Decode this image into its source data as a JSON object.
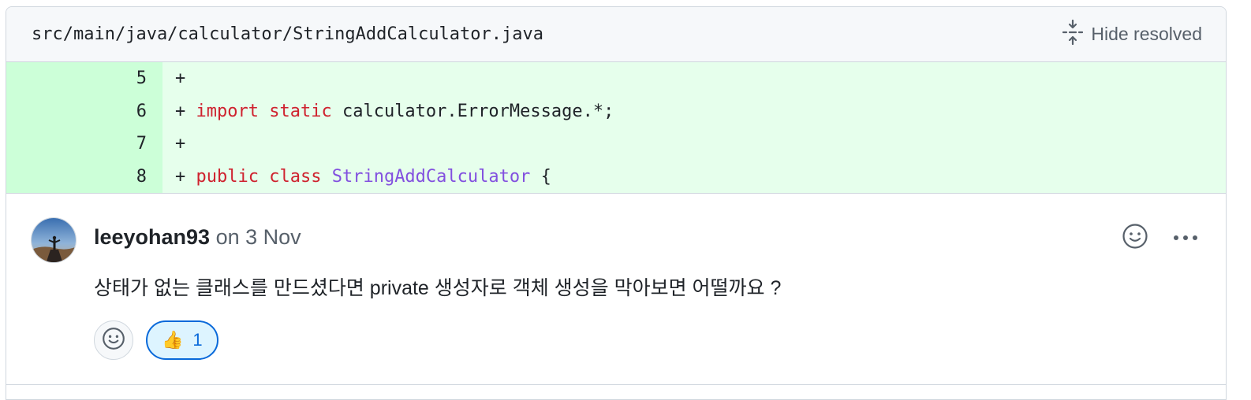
{
  "file": {
    "path": "src/main/java/calculator/StringAddCalculator.java",
    "hide_resolved_label": "Hide resolved"
  },
  "diff": {
    "lines": [
      {
        "number": "5",
        "tokens": [
          {
            "t": "+",
            "k": "plain"
          }
        ]
      },
      {
        "number": "6",
        "tokens": [
          {
            "t": "+ ",
            "k": "plain"
          },
          {
            "t": "import",
            "k": "kw"
          },
          {
            "t": " ",
            "k": "plain"
          },
          {
            "t": "static",
            "k": "kw"
          },
          {
            "t": " calculator.ErrorMessage.*;",
            "k": "plain"
          }
        ]
      },
      {
        "number": "7",
        "tokens": [
          {
            "t": "+",
            "k": "plain"
          }
        ]
      },
      {
        "number": "8",
        "tokens": [
          {
            "t": "+ ",
            "k": "plain"
          },
          {
            "t": "public",
            "k": "kw"
          },
          {
            "t": " ",
            "k": "plain"
          },
          {
            "t": "class",
            "k": "kw"
          },
          {
            "t": " ",
            "k": "plain"
          },
          {
            "t": "StringAddCalculator",
            "k": "cls"
          },
          {
            "t": " {",
            "k": "plain"
          }
        ]
      }
    ]
  },
  "comment": {
    "author": "leeyohan93",
    "date": "on 3 Nov",
    "body": "상태가 없는 클래스를 만드셨다면 private 생성자로 객체 생성을 막아보면 어떨까요 ?",
    "reactions": [
      {
        "emoji": "👍",
        "count": "1"
      }
    ]
  },
  "icons": {
    "hide_resolved": "fold-icon",
    "add_reaction": "smiley-icon",
    "more": "kebab-horizontal-icon"
  },
  "colors": {
    "added_bg": "#e6ffec",
    "added_gutter": "#ccffd8",
    "keyword": "#cf222e",
    "class_name": "#8250df",
    "reaction_border": "#0969da",
    "reaction_bg": "#ddf4ff"
  }
}
